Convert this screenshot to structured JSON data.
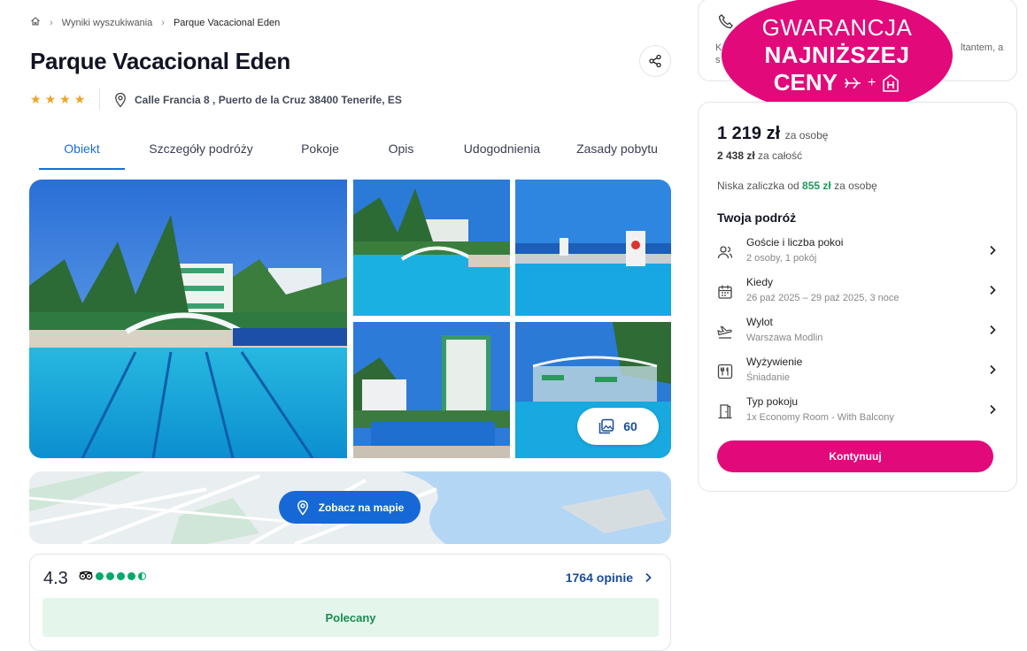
{
  "breadcrumb": {
    "items": [
      "Wyniki wyszukiwania",
      "Parque Vacacional Eden"
    ]
  },
  "hotel": {
    "title": "Parque Vacacional Eden",
    "stars": 4,
    "address": "Calle Francia 8 , Puerto de la Cruz 38400 Tenerife, ES"
  },
  "tabs": [
    {
      "label": "Obiekt",
      "active": true
    },
    {
      "label": "Szczegóły podróży",
      "active": false
    },
    {
      "label": "Pokoje",
      "active": false
    },
    {
      "label": "Opis",
      "active": false
    },
    {
      "label": "Udogodnienia",
      "active": false
    },
    {
      "label": "Zasady pobytu",
      "active": false
    }
  ],
  "gallery": {
    "photos_count": "60"
  },
  "map": {
    "button_label": "Zobacz na mapie"
  },
  "reviews": {
    "rating": "4.3",
    "tripadvisor_bubbles": 4.5,
    "count_label": "1764 opinie",
    "recommended_label": "Polecany"
  },
  "contact": {
    "text_left": "K",
    "text_left2": "s",
    "text_right": "ltantem, a"
  },
  "guarantee": {
    "line1": "GWARANCJA",
    "line2": "NAJNIŻSZEJ",
    "line3": "CENY",
    "plus": "+"
  },
  "booking": {
    "price": "1 219 zł",
    "price_unit": "za osobę",
    "total": "2 438 zł",
    "total_unit": "za całość",
    "deposit_prefix": "Niska zaliczka od",
    "deposit_amount": "855 zł",
    "deposit_unit": "za osobę",
    "trip_title": "Twoja podróż",
    "rows": [
      {
        "label": "Goście i liczba pokoi",
        "value": "2 osoby, 1 pokój",
        "icon": "guests-icon"
      },
      {
        "label": "Kiedy",
        "value": "26 paź 2025 – 29 paź 2025, 3 noce",
        "icon": "calendar-icon"
      },
      {
        "label": "Wylot",
        "value": "Warszawa Modlin",
        "icon": "plane-icon"
      },
      {
        "label": "Wyżywienie",
        "value": "Śniadanie",
        "icon": "meal-icon"
      },
      {
        "label": "Typ pokoju",
        "value": "1x Economy Room - With Balcony",
        "icon": "door-icon"
      }
    ],
    "continue_label": "Kontynuuj"
  },
  "colors": {
    "accent_pink": "#e2097a",
    "link_blue": "#1a6fd8",
    "deposit_green": "#1a9a55",
    "tripadvisor_green": "#00aa6c"
  }
}
